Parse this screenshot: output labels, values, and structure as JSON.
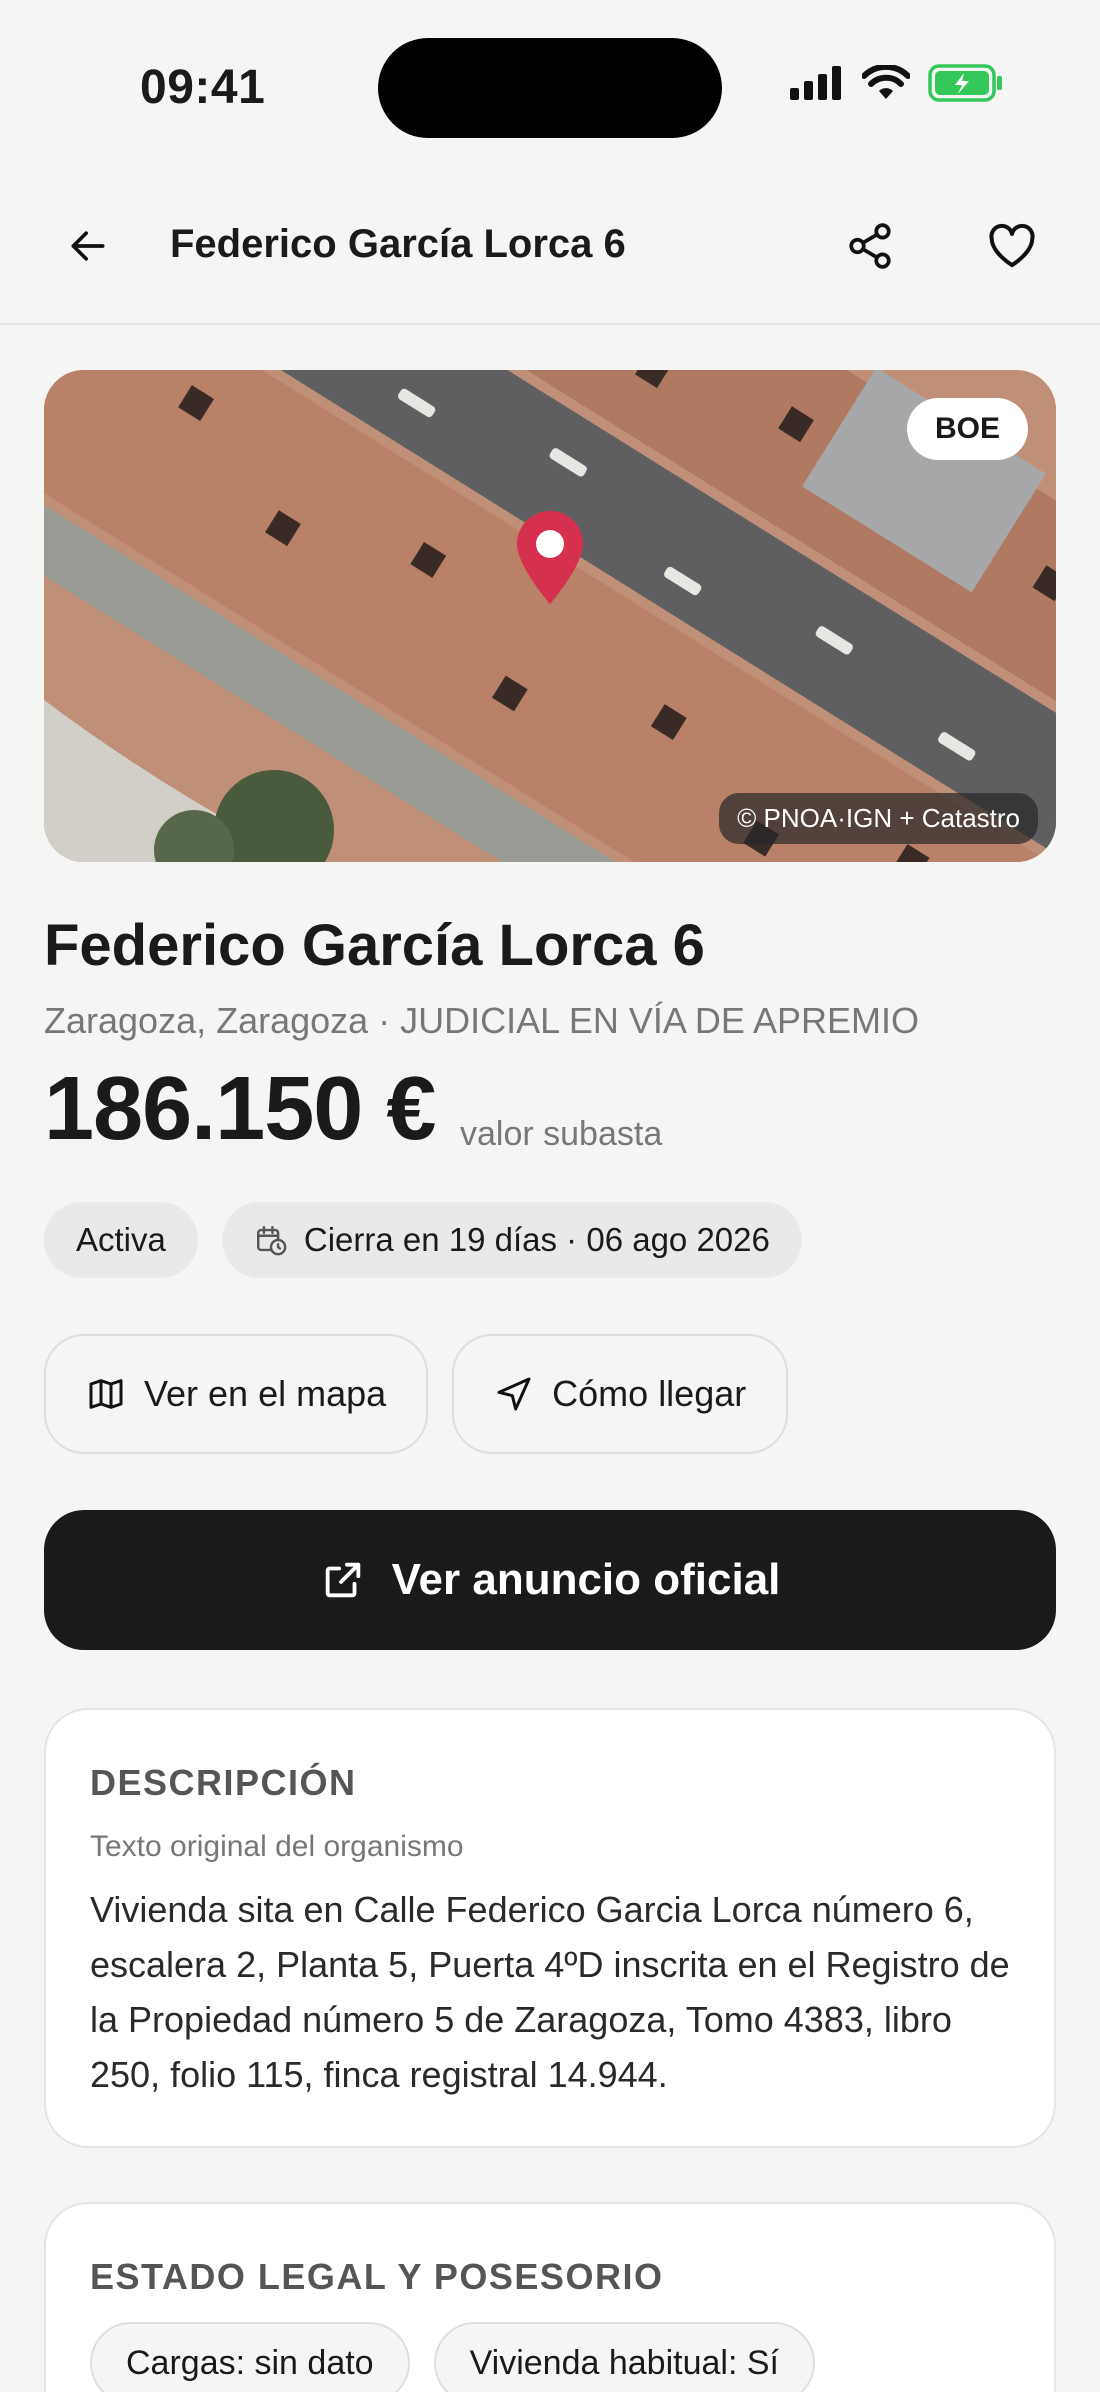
{
  "status_bar": {
    "time": "09:41"
  },
  "header": {
    "title": "Federico García Lorca 6"
  },
  "map": {
    "badge": "BOE",
    "credit": "© PNOA·IGN + Catastro"
  },
  "property": {
    "title": "Federico García Lorca 6",
    "subtitle": "Zaragoza, Zaragoza · JUDICIAL EN VÍA DE APREMIO",
    "price": "186.150 €",
    "price_caption": "valor subasta"
  },
  "chips": {
    "status": "Activa",
    "closing": "Cierra en 19 días · 06 ago 2026"
  },
  "actions": {
    "map": "Ver en el mapa",
    "directions": "Cómo llegar"
  },
  "primary_action": {
    "label": "Ver anuncio oficial"
  },
  "description": {
    "heading": "DESCRIPCIÓN",
    "caption": "Texto original del organismo",
    "body": "Vivienda sita en Calle Federico Garcia Lorca número 6, escalera 2, Planta 5, Puerta 4ºD inscrita en el Registro de la Propiedad número 5 de Zaragoza, Tomo 4383, libro 250, folio 115, finca registral 14.944."
  },
  "legal": {
    "heading": "ESTADO LEGAL Y POSESORIO",
    "chips": [
      "Cargas: sin dato",
      "Vivienda habitual: Sí"
    ]
  },
  "colors": {
    "accent_dark": "#1a1a1a",
    "pin_red": "#d6304f",
    "background": "#f5f5f4",
    "battery_green": "#34c759"
  },
  "icons": [
    "back-arrow-icon",
    "share-icon",
    "heart-icon",
    "map-pin-icon",
    "calendar-clock-icon",
    "map-icon",
    "navigation-icon",
    "external-link-icon",
    "signal-icon",
    "wifi-icon",
    "battery-icon"
  ]
}
